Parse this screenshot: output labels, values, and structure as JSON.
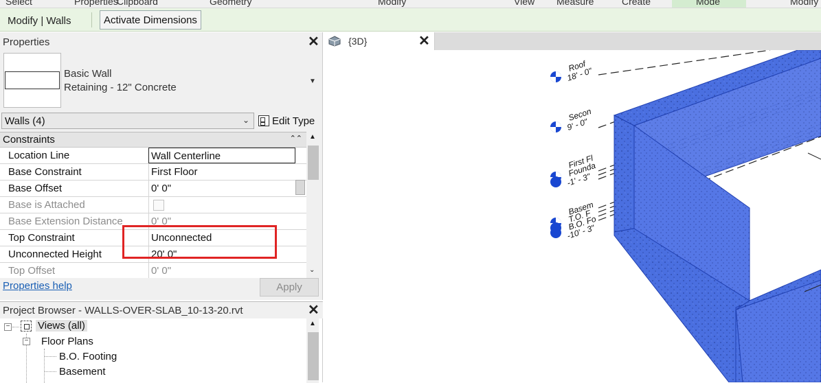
{
  "ribbon": {
    "panels": [
      "Select",
      "Properties",
      "Clipboard",
      "Geometry",
      "Modify",
      "View",
      "Measure",
      "Create",
      "Mode",
      "Modify"
    ],
    "context_title": "Modify | Walls",
    "activate_dimensions": "Activate Dimensions"
  },
  "properties": {
    "title": "Properties",
    "type_family": "Basic Wall",
    "type_name": "Retaining - 12\" Concrete",
    "filter": "Walls (4)",
    "edit_type": "Edit Type",
    "section": "Constraints",
    "rows": [
      {
        "name": "Location Line",
        "value": "Wall Centerline",
        "enabled": true
      },
      {
        "name": "Base Constraint",
        "value": "First Floor",
        "enabled": true
      },
      {
        "name": "Base Offset",
        "value": "0'  0\"",
        "enabled": true
      },
      {
        "name": "Base is Attached",
        "value": "",
        "enabled": false
      },
      {
        "name": "Base Extension Distance",
        "value": "0'  0\"",
        "enabled": false
      },
      {
        "name": "Top Constraint",
        "value": "Unconnected",
        "enabled": true
      },
      {
        "name": "Unconnected Height",
        "value": "20'  0\"",
        "enabled": true
      },
      {
        "name": "Top Offset",
        "value": "0'  0\"",
        "enabled": false
      }
    ],
    "help_link": "Properties help",
    "apply": "Apply"
  },
  "project_browser": {
    "title": "Project Browser - WALLS-OVER-SLAB_10-13-20.rvt",
    "root": "Views (all)",
    "group": "Floor Plans",
    "items": [
      "B.O. Footing",
      "Basement"
    ]
  },
  "view_tab": {
    "label": "{3D}"
  },
  "levels": [
    {
      "name": "Roof",
      "elev": "18' - 0\""
    },
    {
      "name": "Secon",
      "elev": "9' - 0\""
    },
    {
      "name": "First Fl",
      "name2": "Founda",
      "elev": "-1' - 3\""
    },
    {
      "name": "Basem",
      "name2": "T.O. F",
      "name3": "B.O. Fo",
      "elev": "-10' - 3\""
    }
  ],
  "colors": {
    "wall_fill": "#4a6fe0",
    "wall_edge": "#1f3fb0",
    "context_bar": "#e9f4e3",
    "highlight": "#e02424",
    "link": "#1a5fb4"
  }
}
